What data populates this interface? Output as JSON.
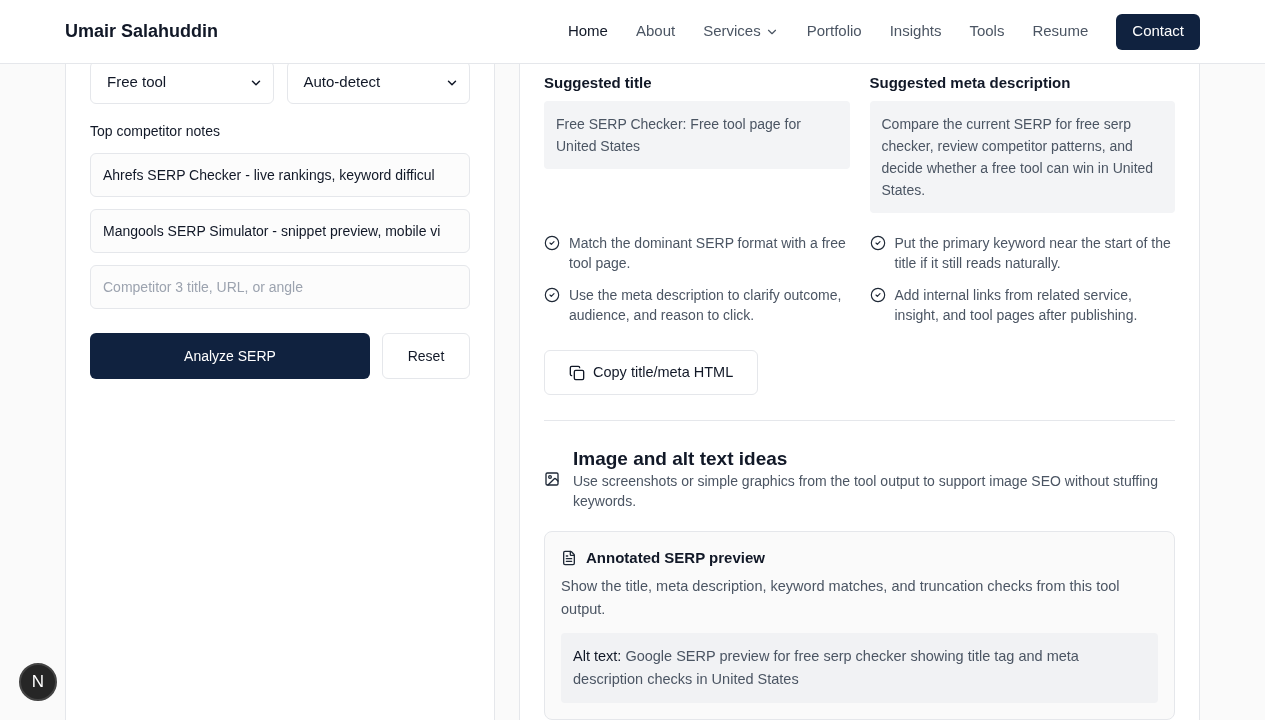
{
  "header": {
    "brand": "Umair Salahuddin",
    "nav": [
      {
        "label": "Home",
        "selected": true,
        "kind": "link"
      },
      {
        "label": "About",
        "selected": false,
        "kind": "link"
      },
      {
        "label": "Services",
        "selected": false,
        "kind": "dropdown"
      },
      {
        "label": "Portfolio",
        "selected": false,
        "kind": "link"
      },
      {
        "label": "Insights",
        "selected": false,
        "kind": "link"
      },
      {
        "label": "Tools",
        "selected": false,
        "kind": "link"
      },
      {
        "label": "Resume",
        "selected": false,
        "kind": "link"
      }
    ],
    "cta": "Contact"
  },
  "form": {
    "selects": [
      {
        "value": "Free tool"
      },
      {
        "value": "Auto-detect"
      }
    ],
    "competitor_label": "Top competitor notes",
    "competitor_fields": [
      {
        "value": "Ahrefs SERP Checker - live rankings, keyword difficul"
      },
      {
        "value": "Mangools SERP Simulator - snippet preview, mobile vi"
      },
      {
        "placeholder": "Competitor 3 title, URL, or angle"
      }
    ],
    "primary_button": "Analyze SERP",
    "secondary_button": "Reset"
  },
  "seo_output": {
    "title_label": "Suggested title",
    "title_value": "Free SERP Checker: Free tool page for United States",
    "meta_label": "Suggested meta description",
    "meta_value": "Compare the current SERP for free serp checker, review competitor patterns, and decide whether a free tool can win in United States.",
    "checks": [
      "Match the dominant SERP format with a free tool page.",
      "Put the primary keyword near the start of the title if it still reads naturally.",
      "Use the meta description to clarify outcome, audience, and reason to click.",
      "Add internal links from related service, insight, and tool pages after publishing."
    ],
    "copy_button": "Copy title/meta HTML"
  },
  "image_ideas": {
    "title": "Image and alt text ideas",
    "description": "Use screenshots or simple graphics from the tool output to support image SEO without stuffing keywords.",
    "cards": [
      {
        "title": "Annotated SERP preview",
        "description": "Show the title, meta description, keyword matches, and truncation checks from this tool output.",
        "alt_text": "**Alt text:** Google SERP preview for free serp checker showing title tag and meta description checks in United States"
      }
    ]
  },
  "dev_badge": {
    "label": "N"
  }
}
